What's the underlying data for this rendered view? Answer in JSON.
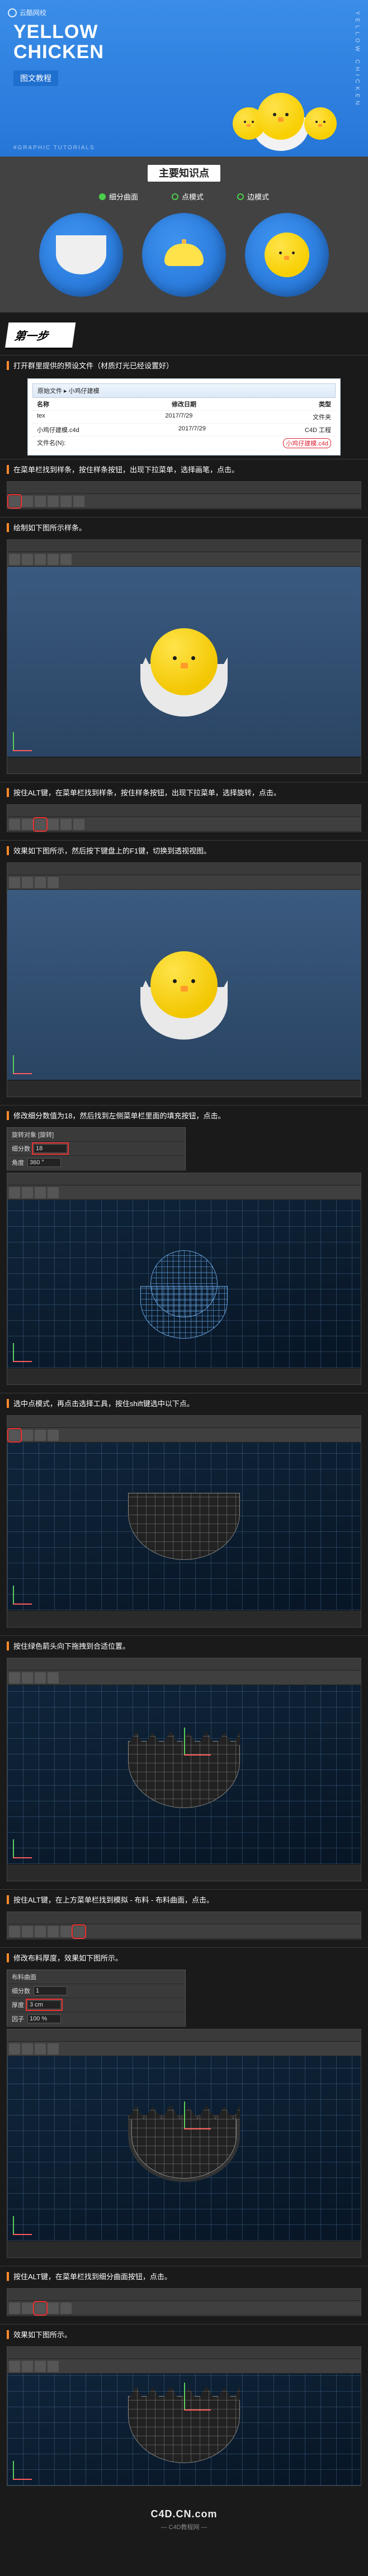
{
  "hero": {
    "brand": "云酷网校",
    "title_line1": "YELLOW",
    "title_line2": "CHICKEN",
    "badge": "图文教程",
    "vertical": "YELLOW CHICKEN",
    "subgraphic": "#GRAPHIC TUTORIALS"
  },
  "kp": {
    "title": "主要知识点",
    "modes": [
      {
        "dot": "active",
        "label": "细分曲面"
      },
      {
        "dot": "",
        "label": "点模式"
      },
      {
        "dot": "",
        "label": "边模式"
      }
    ]
  },
  "step1": {
    "label": "第一步"
  },
  "instr": {
    "i1": "打开群里提供的预设文件（材质灯光已经设置好）",
    "i2": "在菜单栏找到样条，按住样条按钮，出现下拉菜单，选择画笔，点击。",
    "i3": "绘制如下图所示样条。",
    "i4": "按住ALT键，在菜单栏找到样条，按住样条按钮，出现下拉菜单，选择旋转，点击。",
    "i5": "效果如下图所示，然后按下键盘上的F1键，切换到透视视图。",
    "i6": "修改细分数值为18，然后找到左侧菜单栏里面的填充按钮，点击。",
    "i7": "选中点模式，再点击选择工具，按住shift键选中以下点。",
    "i8": "按住绿色箭头向下拖拽到合适位置。",
    "i9": "按住ALT键，在上方菜单栏找到模拟 - 布料 - 布料曲面，点击。",
    "i10": "修改布料厚度，效果如下图所示。",
    "i11": "按住ALT键，在菜单栏找到细分曲面按钮，点击。",
    "i12": "效果如下图所示。"
  },
  "file": {
    "path": "原始文件 ▸ 小鸡仔建模",
    "cols": [
      "名称",
      "修改日期",
      "类型"
    ],
    "rows": [
      {
        "name": "tex",
        "date": "2017/7/29",
        "type": "文件夹"
      },
      {
        "name": "小鸡仔建模.c4d",
        "date": "2017/7/29",
        "type": "C4D 工程"
      }
    ],
    "field_label": "文件名(N):",
    "highlight": "小鸡仔建模.c4d"
  },
  "panel_subdiv": {
    "label_a": "旋转对象 [旋转]",
    "label_b": "细分数",
    "value_b": "18",
    "label_c": "角度",
    "value_c": "360 °"
  },
  "panel_cloth": {
    "title": "布料曲面",
    "label_a": "细分数",
    "value_a": "1",
    "label_b": "厚度",
    "value_b": "3 cm",
    "label_c": "因子",
    "value_c": "100 %"
  },
  "footer": {
    "domain": "C4D.CN.com",
    "tag": "— C4D教程网 —"
  }
}
